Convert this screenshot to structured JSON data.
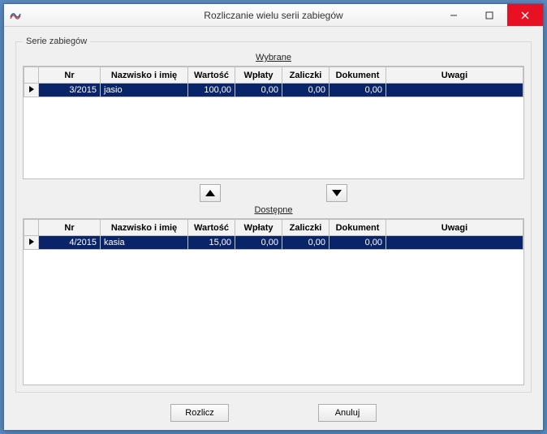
{
  "window": {
    "title": "Rozliczanie wielu serii zabiegów"
  },
  "group_label": "Serie zabiegów",
  "sections": {
    "selected_label": "Wybrane",
    "available_label": "Dostępne"
  },
  "columns": {
    "nr": "Nr",
    "name": "Nazwisko i imię",
    "value": "Wartość",
    "payments": "Wpłaty",
    "advances": "Zaliczki",
    "document": "Dokument",
    "notes": "Uwagi"
  },
  "selected_rows": [
    {
      "nr": "3/2015",
      "name": "jasio",
      "value": "100,00",
      "payments": "0,00",
      "advances": "0,00",
      "document": "0,00",
      "notes": ""
    }
  ],
  "available_rows": [
    {
      "nr": "4/2015",
      "name": "kasia",
      "value": "15,00",
      "payments": "0,00",
      "advances": "0,00",
      "document": "0,00",
      "notes": ""
    }
  ],
  "buttons": {
    "settle": "Rozlicz",
    "cancel": "Anuluj"
  }
}
